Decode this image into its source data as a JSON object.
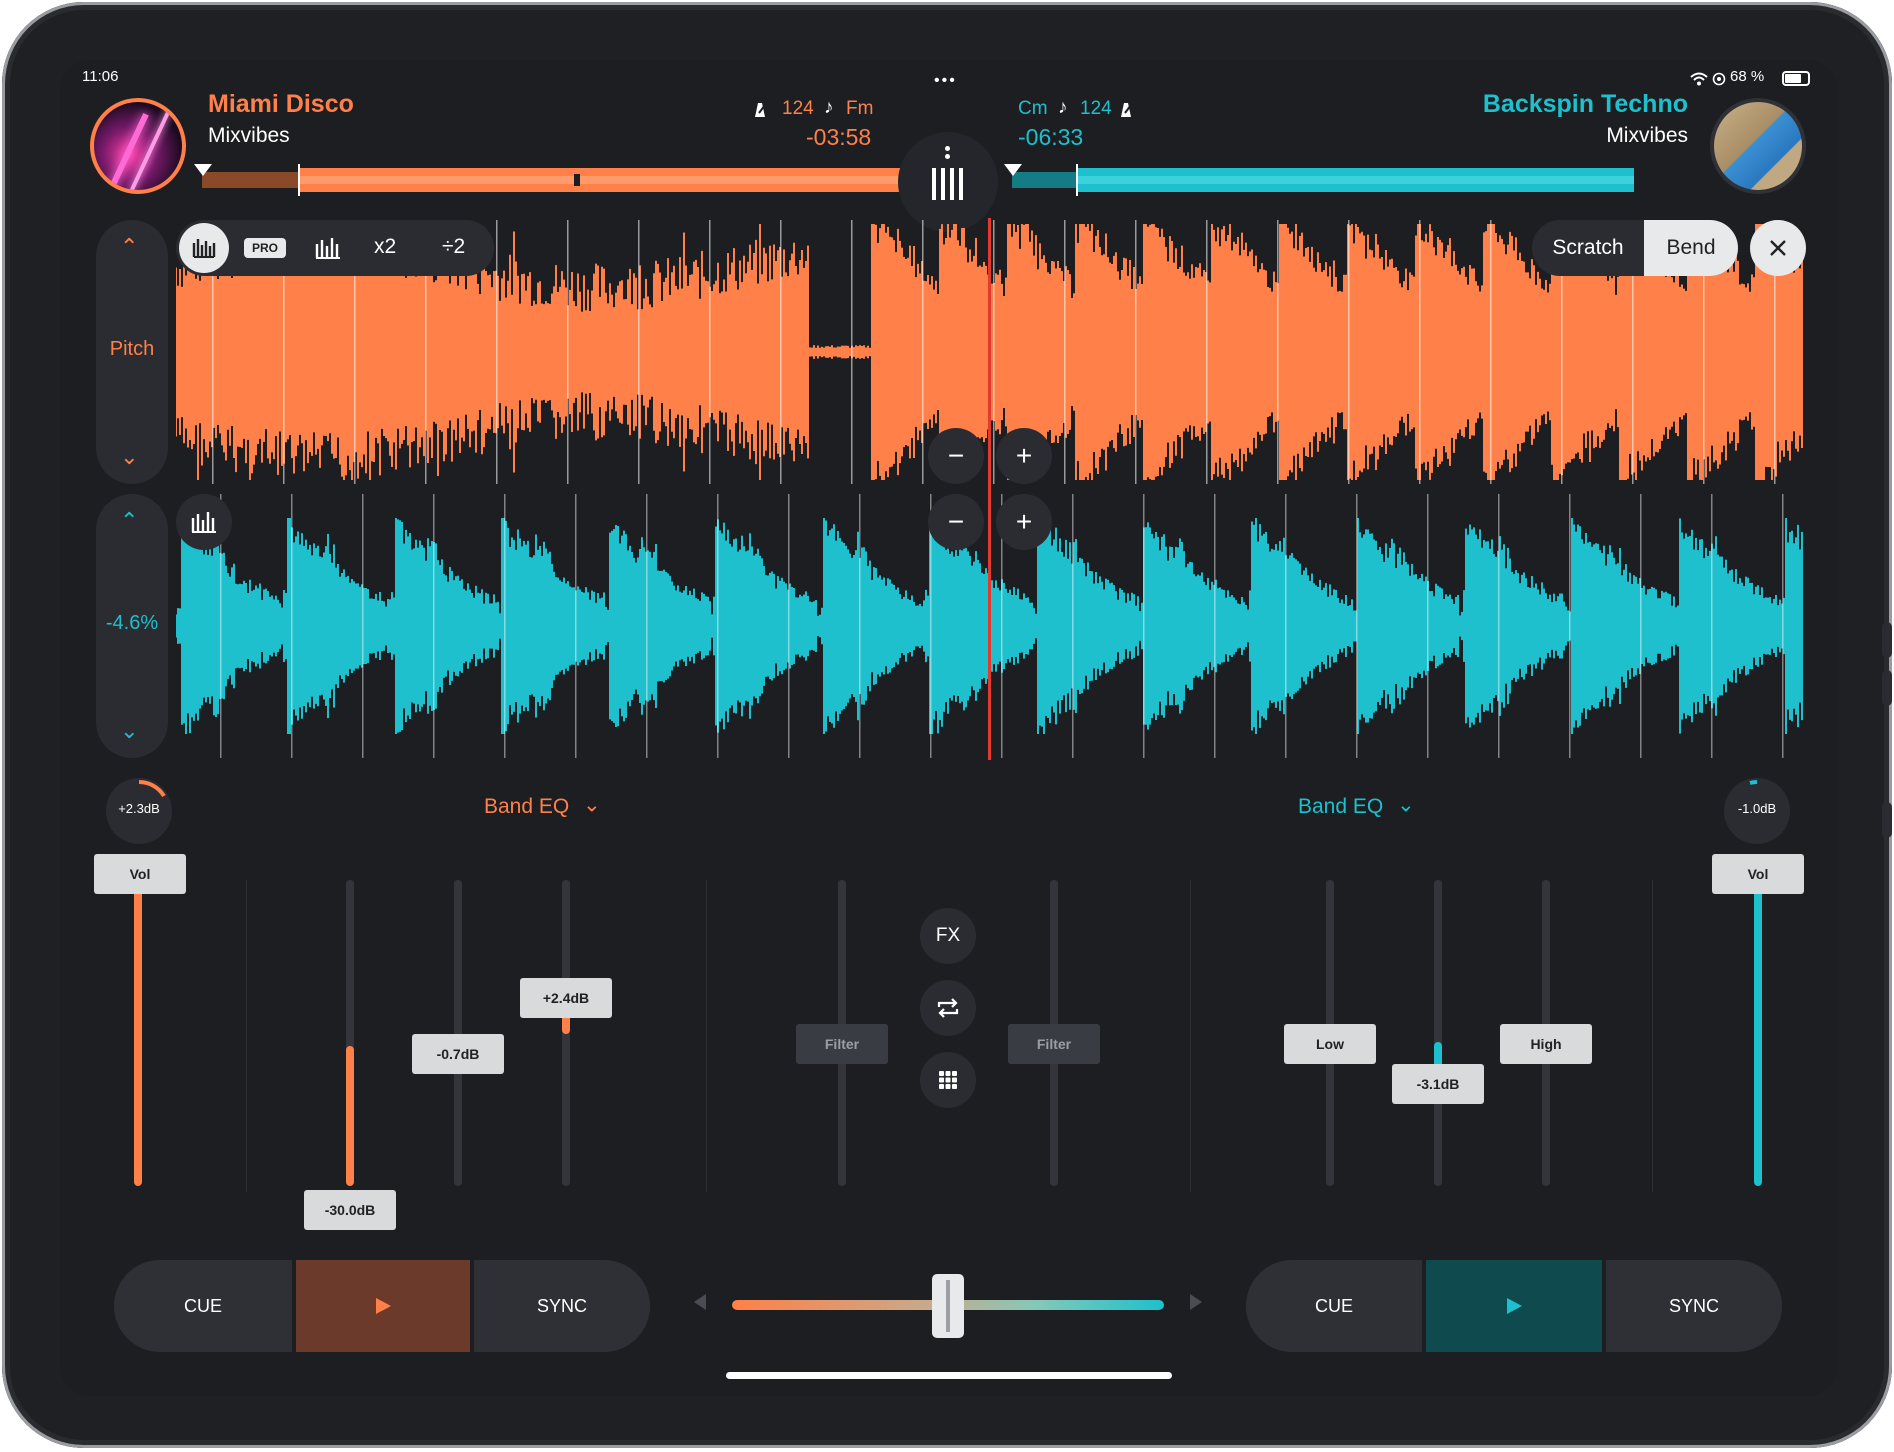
{
  "status_bar": {
    "time": "11:06",
    "battery": "68 %",
    "icons": [
      "wifi-icon",
      "location-icon",
      "battery-icon"
    ]
  },
  "deck_left": {
    "title": "Miami Disco",
    "artist": "Mixvibes",
    "bpm": "124",
    "key": "Fm",
    "remaining": "-03:58",
    "pitch_label": "Pitch",
    "accent": "#ff8048",
    "gain": "+2.3dB",
    "eq_mode": "Band EQ",
    "vol_label": "Vol",
    "eq_faders": [
      "-30.0dB",
      "-0.7dB",
      "+2.4dB"
    ],
    "transport": {
      "cue": "CUE",
      "sync": "SYNC"
    },
    "toolbar": {
      "pro": "PRO",
      "x2": "x2",
      "div2": "÷2"
    }
  },
  "deck_right": {
    "title": "Backspin Techno",
    "artist": "Mixvibes",
    "bpm": "124",
    "key": "Cm",
    "remaining": "-06:33",
    "pitch_value": "-4.6%",
    "accent": "#1dc0cc",
    "gain": "-1.0dB",
    "eq_mode": "Band EQ",
    "vol_label": "Vol",
    "eq_faders": [
      "Low",
      "-3.1dB",
      "High"
    ],
    "transport": {
      "cue": "CUE",
      "sync": "SYNC"
    }
  },
  "mixer": {
    "filter_left": "Filter",
    "filter_right": "Filter",
    "fx": "FX",
    "mode_scratch": "Scratch",
    "mode_bend": "Bend"
  }
}
